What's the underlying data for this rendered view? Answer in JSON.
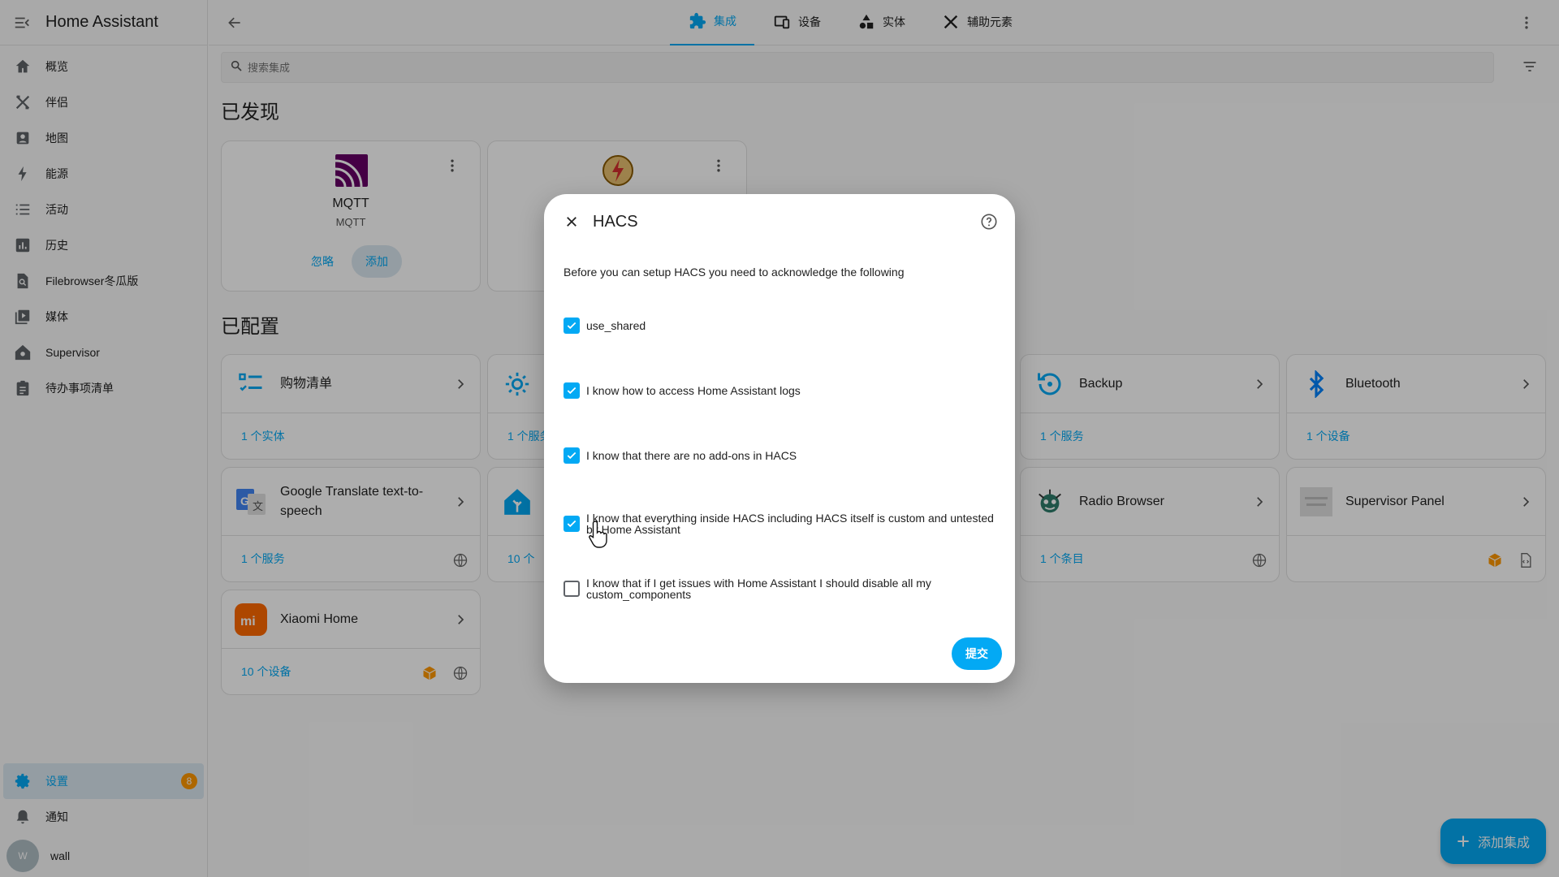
{
  "app": {
    "title": "Home Assistant"
  },
  "sidebar": {
    "items": [
      {
        "label": "概览",
        "icon": "home-icon"
      },
      {
        "label": "伴侣",
        "icon": "tools-icon"
      },
      {
        "label": "地图",
        "icon": "map-icon"
      },
      {
        "label": "能源",
        "icon": "lightning-icon"
      },
      {
        "label": "活动",
        "icon": "list-icon"
      },
      {
        "label": "历史",
        "icon": "chart-icon"
      },
      {
        "label": "Filebrowser冬瓜版",
        "icon": "file-search-icon"
      },
      {
        "label": "媒体",
        "icon": "media-icon"
      },
      {
        "label": "Supervisor",
        "icon": "supervisor-icon"
      },
      {
        "label": "待办事项清单",
        "icon": "clipboard-icon"
      }
    ],
    "settings": {
      "label": "设置",
      "badge": "8"
    },
    "notifications": {
      "label": "通知"
    },
    "user": {
      "name": "wall",
      "initial": "W"
    }
  },
  "tabs": [
    {
      "label": "集成",
      "active": true
    },
    {
      "label": "设备",
      "active": false
    },
    {
      "label": "实体",
      "active": false
    },
    {
      "label": "辅助元素",
      "active": false
    }
  ],
  "search": {
    "placeholder": "搜索集成"
  },
  "discovered": {
    "heading": "已发现",
    "cards": [
      {
        "title": "MQTT",
        "subtitle": "MQTT",
        "ignore": "忽略",
        "add": "添加"
      }
    ]
  },
  "configured": {
    "heading": "已配置",
    "cards": [
      {
        "title": "购物清单",
        "link": "1 个实体"
      },
      {
        "title": "",
        "link": "1 个服务"
      },
      {
        "title": "Backup",
        "link": "1 个服务"
      },
      {
        "title": "Bluetooth",
        "link": "1 个设备"
      },
      {
        "title": "Google Translate text-to-speech",
        "link": "1 个服务"
      },
      {
        "title": "",
        "link": "10 个"
      },
      {
        "title": "Radio Browser",
        "link": "1 个条目"
      },
      {
        "title": "Supervisor Panel",
        "link": ""
      },
      {
        "title": "Xiaomi Home",
        "link": "10 个设备"
      }
    ]
  },
  "dialog": {
    "title": "HACS",
    "description": "Before you can setup HACS you need to acknowledge the following",
    "checks": [
      {
        "label": "use_shared",
        "checked": true
      },
      {
        "label": "I know how to access Home Assistant logs",
        "checked": true
      },
      {
        "label": "I know that there are no add-ons in HACS",
        "checked": true
      },
      {
        "label": "I know that everything inside HACS including HACS itself is custom and untested by Home Assistant",
        "checked": true
      },
      {
        "label": "I know that if I get issues with Home Assistant I should disable all my custom_components",
        "checked": false
      }
    ],
    "submit": "提交"
  },
  "fab": {
    "label": "添加集成"
  },
  "colors": {
    "accent": "#03a9f4",
    "badge": "#ff9800",
    "mqtt": "#660066",
    "xiaomi": "#ff6900"
  }
}
